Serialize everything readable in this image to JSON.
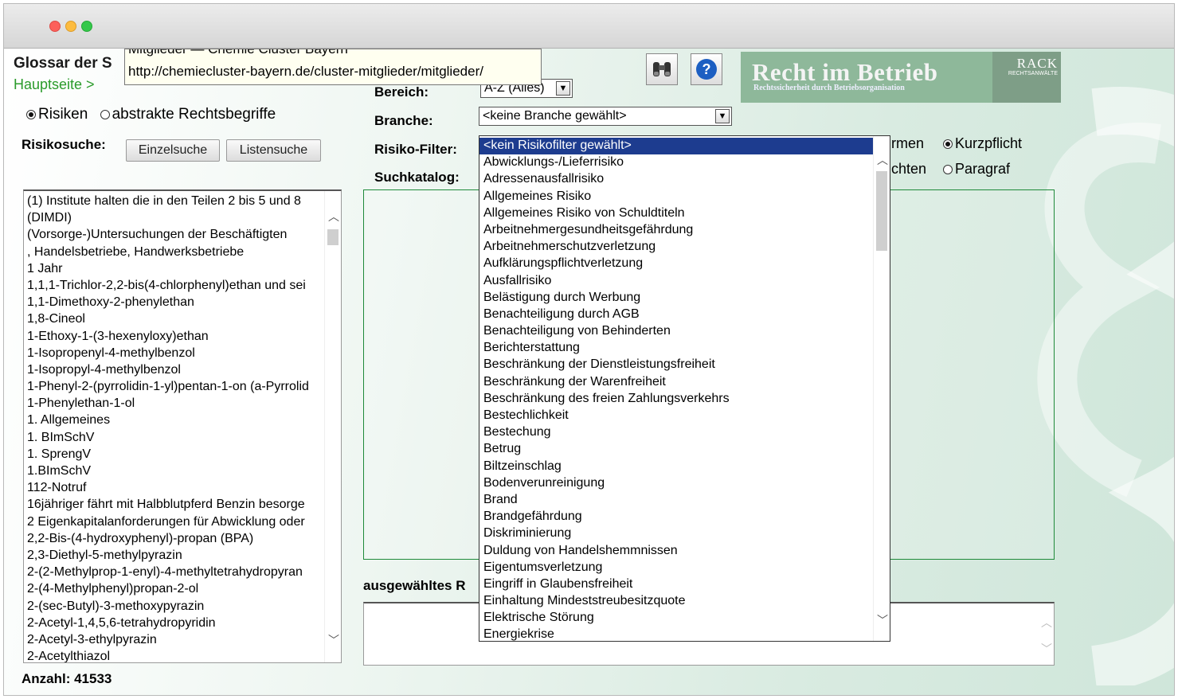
{
  "window": {
    "traffic_lights": [
      "close",
      "minimize",
      "zoom"
    ]
  },
  "tooltip": {
    "title": "Mitglieder — Chemie Cluster Bayern",
    "url": "http://chemiecluster-bayern.de/cluster-mitglieder/mitglieder/"
  },
  "header": {
    "title": "Glossar der S",
    "home_link": "Hauptseite >"
  },
  "mode_radio": [
    {
      "label": "Risiken",
      "checked": true
    },
    {
      "label": "abstrakte Rechtsbegriffe",
      "checked": false
    }
  ],
  "search": {
    "label": "Risikosuche:",
    "single_button": "Einzelsuche",
    "list_button": "Listensuche"
  },
  "terms": [
    "(1) Institute halten die in den Teilen 2 bis 5 und 8",
    "(DIMDI)",
    "(Vorsorge-)Untersuchungen der Beschäftigten",
    ", Handelsbetriebe, Handwerksbetriebe",
    "1 Jahr",
    "1,1,1-Trichlor-2,2-bis(4-chlorphenyl)ethan und sei",
    "1,1-Dimethoxy-2-phenylethan",
    "1,8-Cineol",
    "1-Ethoxy-1-(3-hexenyloxy)ethan",
    "1-Isopropenyl-4-methylbenzol",
    "1-Isopropyl-4-methylbenzol",
    "1-Phenyl-2-(pyrrolidin-1-yl)pentan-1-on (a-Pyrrolid",
    "1-Phenylethan-1-ol",
    "1. Allgemeines",
    "1. BImSchV",
    "1. SprengV",
    "1.BImSchV",
    "112-Notruf",
    "16jähriger fährt mit Halbblutpferd Benzin besorge",
    "2 Eigenkapitalanforderungen für Abwicklung oder",
    "2,2-Bis-(4-hydroxyphenyl)-propan (BPA)",
    "2,3-Diethyl-5-methylpyrazin",
    "2-(2-Methylprop-1-enyl)-4-methyltetrahydropyran",
    "2-(4-Methylphenyl)propan-2-ol",
    "2-(sec-Butyl)-3-methoxypyrazin",
    "2-Acetyl-1,4,5,6-tetrahydropyridin",
    "2-Acetyl-3-ethylpyrazin",
    "2-Acetylthiazol"
  ],
  "count": {
    "text": "Anzahl: 41533"
  },
  "filters": {
    "bereich_label": "Bereich:",
    "bereich_value": "A-Z (Alles)",
    "branche_label": "Branche:",
    "branche_value": "<keine Branche gewählt>",
    "risiko_label": "Risiko-Filter:",
    "risiko_value": "<kein Risikofilter gewählt>",
    "suchkatalog_label": "Suchkatalog:"
  },
  "view_options": {
    "partial_top": "rmen",
    "partial_bottom": "chten",
    "kurzpflicht": {
      "label": "Kurzpflicht",
      "checked": true
    },
    "paragraf": {
      "label": "Paragraf",
      "checked": false
    }
  },
  "selected_label": "ausgewähltes R",
  "banner": {
    "title": "Recht im Betrieb",
    "subtitle": "Rechtssicherheit durch Betriebsorganisation",
    "brand": "RACK",
    "brand_sub": "RECHTSANWÄLTE"
  },
  "risk_options": [
    "<kein Risikofilter gewählt>",
    "Abwicklungs-/Lieferrisiko",
    "Adressenausfallrisiko",
    "Allgemeines Risiko",
    "Allgemeines Risiko von Schuldtiteln",
    "Arbeitnehmergesundheitsgefährdung",
    "Arbeitnehmerschutzverletzung",
    "Aufklärungspflichtverletzung",
    "Ausfallrisiko",
    "Belästigung durch Werbung",
    "Benachteiligung durch AGB",
    "Benachteiligung von Behinderten",
    "Berichterstattung",
    "Beschränkung der Dienstleistungsfreiheit",
    "Beschränkung der Warenfreiheit",
    "Beschränkung des freien Zahlungsverkehrs",
    "Bestechlichkeit",
    "Bestechung",
    "Betrug",
    "Biltzeinschlag",
    "Bodenverunreinigung",
    "Brand",
    "Brandgefährdung",
    "Diskriminierung",
    "Duldung von Handelshemmnissen",
    "Eigentumsverletzung",
    "Eingriff in Glaubensfreiheit",
    "Einhaltung Mindeststreubesitzquote",
    "Elektrische Störung",
    "Energiekrise"
  ],
  "colors": {
    "accent_green": "#2b9b2b",
    "selection_blue": "#1d3c8f",
    "banner_green": "#8eb89a"
  }
}
